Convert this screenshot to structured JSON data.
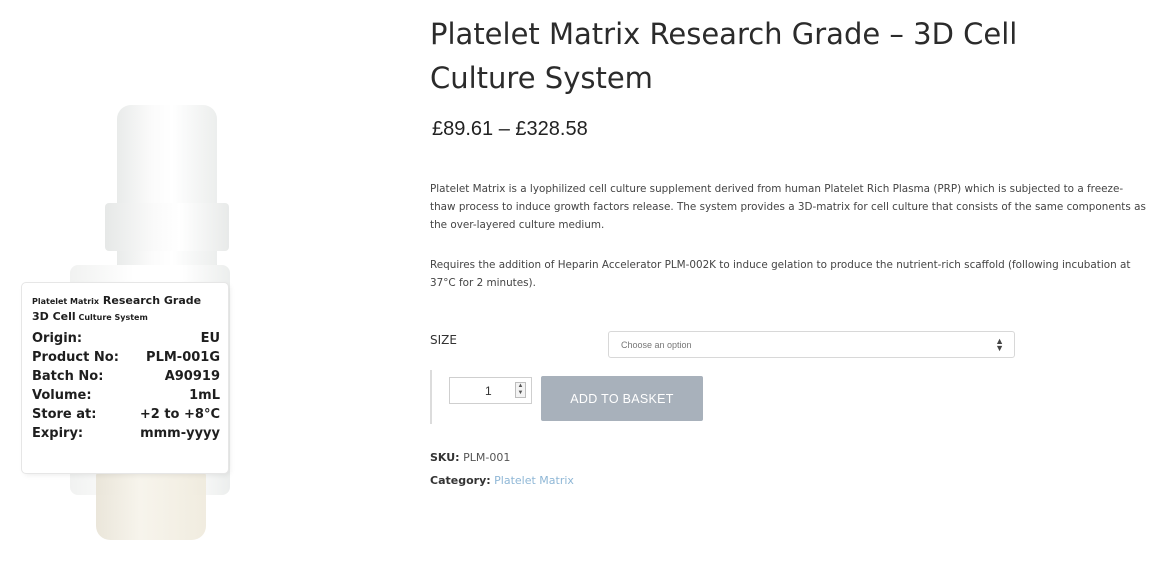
{
  "product": {
    "title": "Platelet Matrix Research Grade – 3D Cell Culture System",
    "price_range": "£89.61  –  £328.58",
    "description_1": "Platelet Matrix is a lyophilized cell culture supplement derived from human Platelet Rich Plasma (PRP) which is subjected to a freeze-thaw process to induce growth factors release. The system provides a 3D-matrix for cell culture that consists of the same components as the over-layered culture medium.",
    "description_2": "Requires the addition of Heparin Accelerator PLM-002K to induce gelation to produce the nutrient-rich scaffold (following incubation at 37°C for 2 minutes)."
  },
  "vial_label": {
    "title_small": "Platelet Matrix",
    "title_bold": " Research Grade",
    "subtitle_bold": "3D Cell",
    "subtitle_small": " Culture System",
    "rows": [
      {
        "key": "Origin:",
        "value": "EU"
      },
      {
        "key": "Product No:",
        "value": "PLM-001G"
      },
      {
        "key": "Batch No:",
        "value": "A90919"
      },
      {
        "key": "Volume:",
        "value": "1mL"
      },
      {
        "key": "Store at:",
        "value": "+2 to +8°C"
      },
      {
        "key": "Expiry:",
        "value": "mmm-yyyy"
      }
    ]
  },
  "variation": {
    "size_label": "SIZE",
    "select_placeholder": "Choose an option"
  },
  "cart": {
    "quantity": "1",
    "add_label": "ADD TO BASKET"
  },
  "meta": {
    "sku_label": "SKU:",
    "sku_value": "PLM-001",
    "category_label": "Category:",
    "category_value": "Platelet Matrix"
  },
  "colors": {
    "button_bg": "#a8b1bb",
    "link": "#8fb7d6"
  }
}
